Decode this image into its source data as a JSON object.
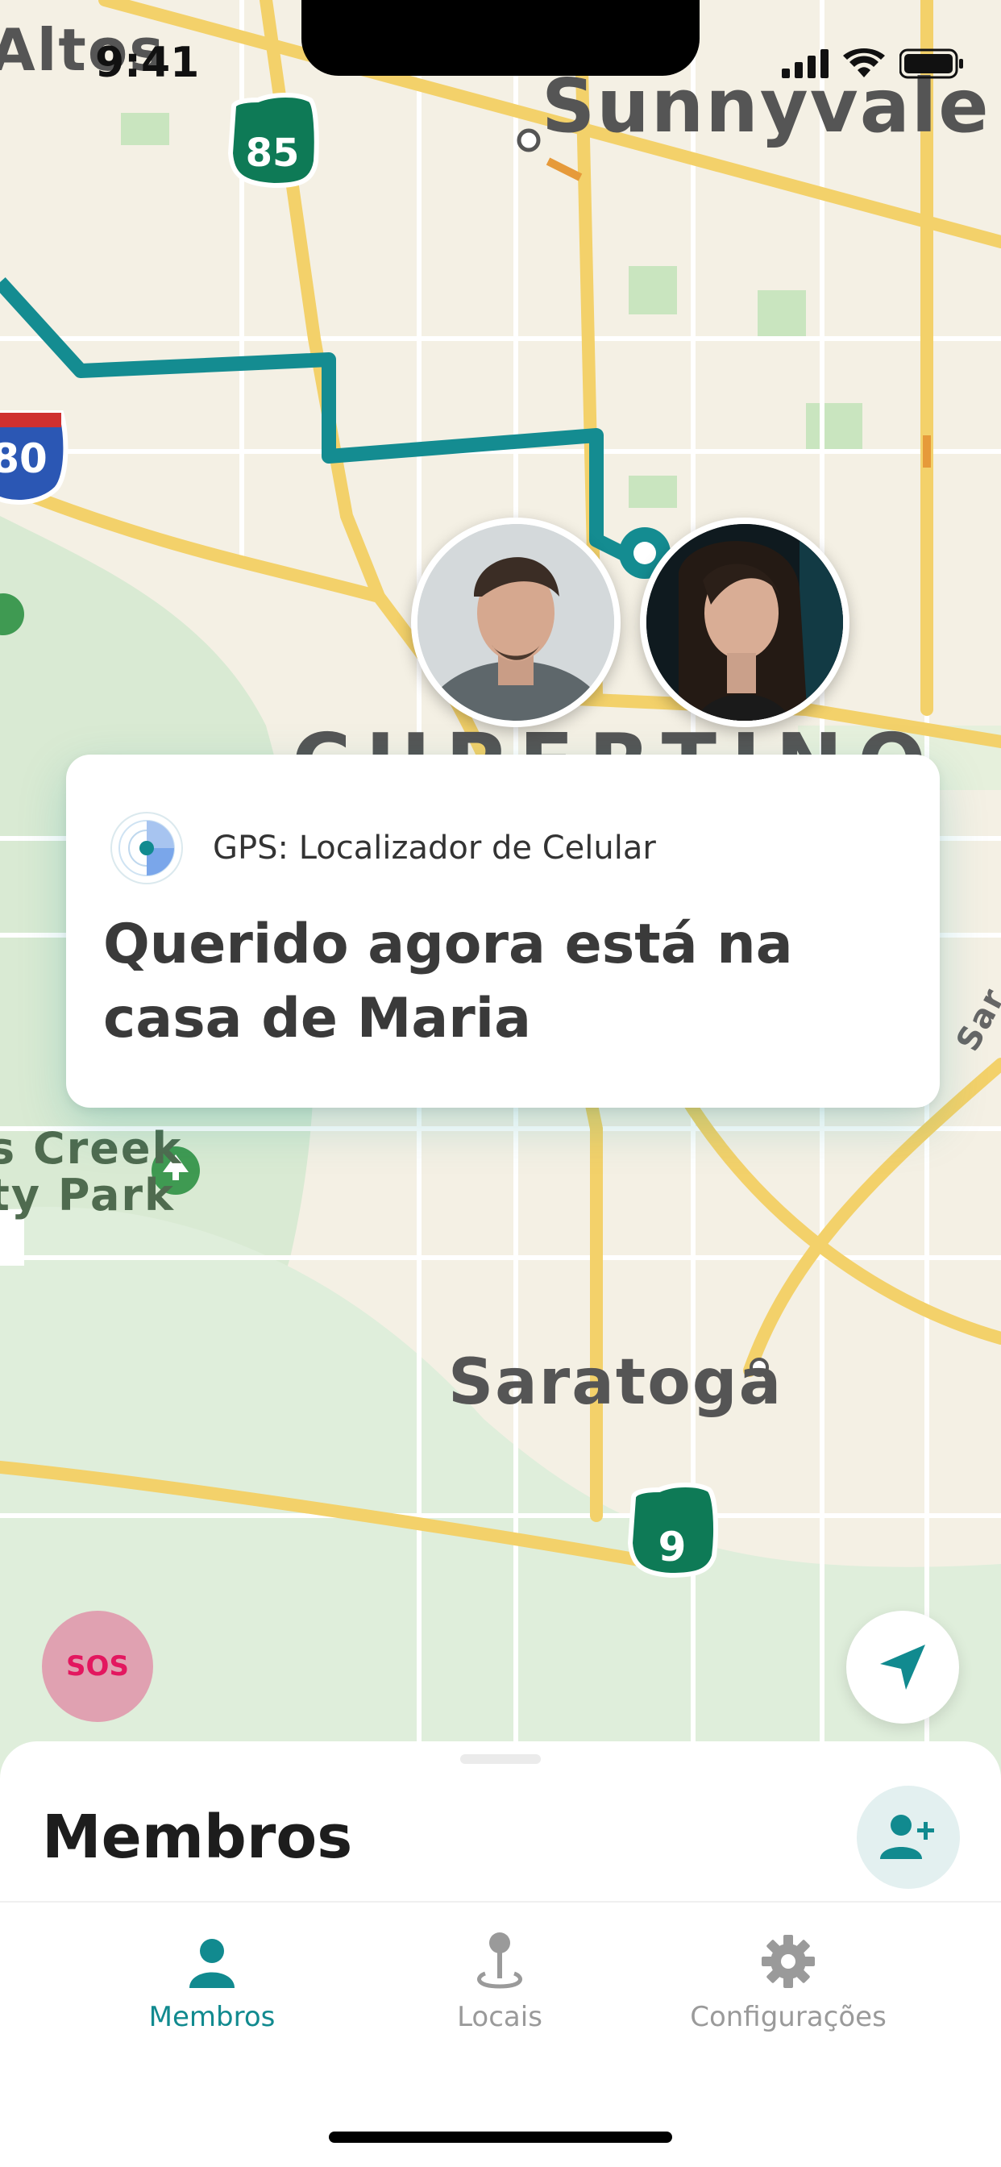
{
  "status_bar": {
    "time": "9:41"
  },
  "map": {
    "labels": {
      "city_1": "Sunnyvale",
      "city_2": "Altos",
      "city_3": "CUPERTINO",
      "city_4": "Saratoga",
      "park": "s Creek\nty Park",
      "edge": "Sar"
    },
    "shields": {
      "route_85": "85",
      "route_80": "80",
      "route_9": "9"
    },
    "route_color": "#148c91"
  },
  "notification": {
    "app_name": "GPS: Localizador de Celular",
    "message": "Querido agora está na casa de Maria"
  },
  "sos_button": {
    "label": "SOS"
  },
  "sheet": {
    "title": "Membros"
  },
  "tabs": [
    {
      "label": "Membros",
      "icon": "person-icon",
      "active": true
    },
    {
      "label": "Locais",
      "icon": "location-pin-icon",
      "active": false
    },
    {
      "label": "Configurações",
      "icon": "gear-icon",
      "active": false
    }
  ],
  "colors": {
    "accent": "#118a8f",
    "sos_bg": "#e0a1b1",
    "sos_text": "#e3175f"
  }
}
